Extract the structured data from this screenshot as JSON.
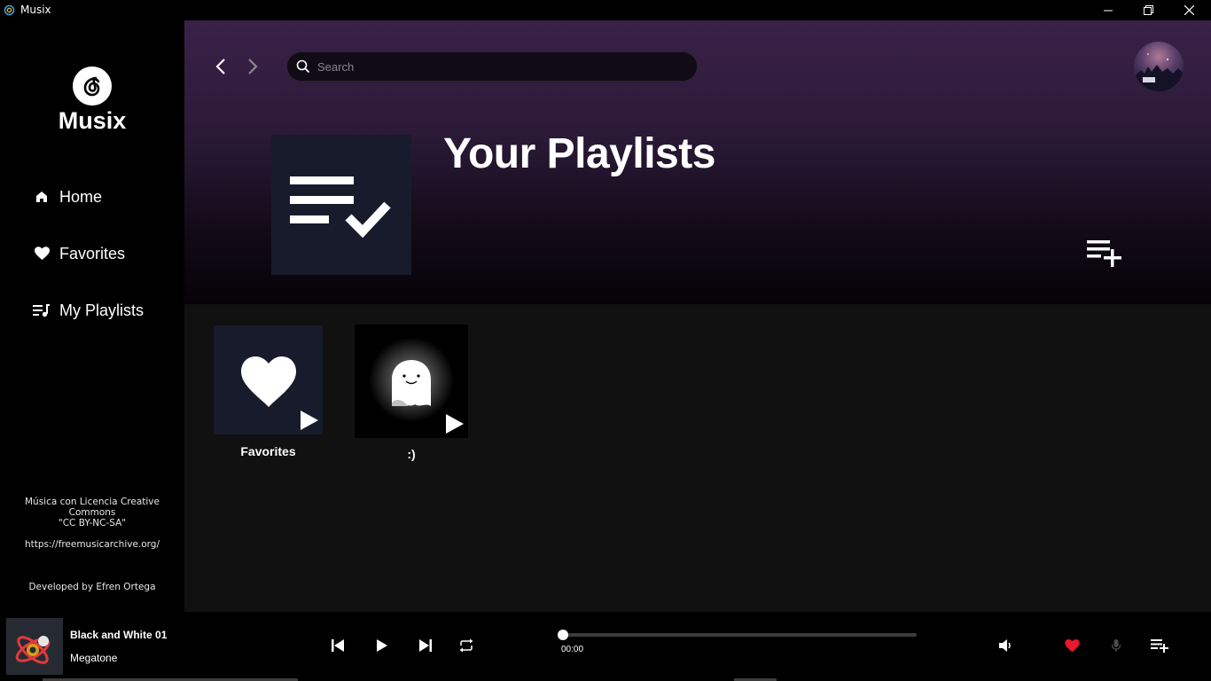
{
  "window": {
    "title": "Musix",
    "controls": [
      "minimize",
      "restore",
      "close"
    ]
  },
  "sidebar": {
    "logo_icon": "netease-music-icon",
    "logo_text": "Musix",
    "items": [
      {
        "label": "Home",
        "icon": "home-icon"
      },
      {
        "label": "Favorites",
        "icon": "heart-icon"
      },
      {
        "label": "My Playlists",
        "icon": "playlist-icon"
      }
    ],
    "credits": {
      "line1": "Música con Licencia Creative Commons",
      "line2": "\"CC BY-NC-SA\"",
      "line3": "https://freemusicarchive.org/",
      "developer": "Developed by Efren Ortega"
    }
  },
  "header": {
    "search_placeholder": "Search",
    "title": "Your Playlists",
    "cover_icon": "playlist-check-icon",
    "add_icon": "playlist-add-icon"
  },
  "playlists": [
    {
      "label": "Favorites",
      "art": "heart",
      "bg": "#181b2c"
    },
    {
      "label": ":)",
      "art": "ghost",
      "bg": "#000000"
    }
  ],
  "player": {
    "track_title": "Black and White 01",
    "track_artist": "Megatone",
    "current_time": "00:00",
    "progress": 0,
    "favorite": true,
    "colors": {
      "heart": "#e8182f"
    }
  }
}
